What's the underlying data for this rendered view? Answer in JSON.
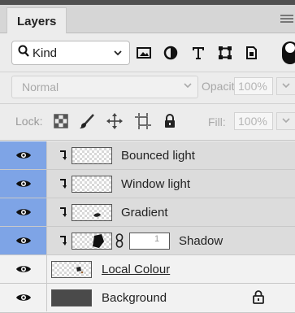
{
  "panel": {
    "title": "Layers"
  },
  "filter": {
    "kind_label": "Kind",
    "filter_icons": [
      "image-filter-icon",
      "adjustment-filter-icon",
      "type-filter-icon",
      "shape-filter-icon",
      "smart-object-filter-icon",
      "toggle-filter-icon"
    ]
  },
  "blend": {
    "mode": "Normal",
    "opacity_label": "Opacity:",
    "opacity_value": "100%"
  },
  "lock": {
    "label": "Lock:",
    "fill_label": "Fill:",
    "fill_value": "100%"
  },
  "layers": [
    {
      "name": "Bounced light",
      "visible": true,
      "selected": true,
      "clipped": true,
      "thumb": "transparent"
    },
    {
      "name": "Window light",
      "visible": true,
      "selected": true,
      "clipped": true,
      "thumb": "transparent"
    },
    {
      "name": "Gradient",
      "visible": true,
      "selected": true,
      "clipped": true,
      "thumb": "transparent"
    },
    {
      "name": "Shadow",
      "visible": true,
      "selected": true,
      "clipped": true,
      "thumb": "transparent",
      "mask": "white",
      "mask_text": "1"
    },
    {
      "name": "Local Colour",
      "visible": true,
      "selected": false,
      "clipped": false,
      "thumb": "transparent"
    },
    {
      "name": "Background",
      "visible": true,
      "selected": false,
      "clipped": false,
      "thumb": "dark",
      "locked": true
    }
  ],
  "colors": {
    "selection_blue": "#7ea4e6",
    "panel_bg": "#ececec"
  }
}
